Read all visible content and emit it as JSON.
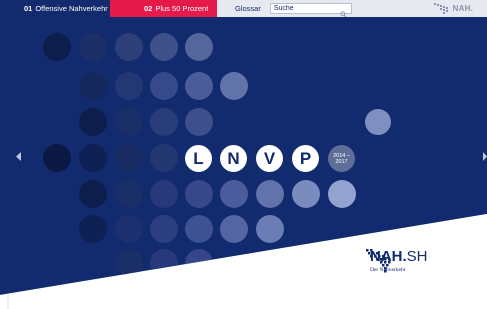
{
  "colors": {
    "navy": "#122a6e",
    "red": "#e5194a",
    "topbar_bg": "#e6e9f0",
    "white": "#ffffff"
  },
  "nav": {
    "tabs": [
      {
        "number": "01",
        "label": "Offensive Nahverkehr"
      },
      {
        "number": "02",
        "label": "Plus 50 Prozent"
      }
    ],
    "glossar_label": "Glossar",
    "search": {
      "placeholder": "Suche",
      "value": ""
    },
    "logo_text": "NAH."
  },
  "hero": {
    "letters": [
      "L",
      "N",
      "V",
      "P"
    ],
    "years": {
      "start": "2014 –",
      "end": "2017"
    }
  },
  "brand": {
    "name_bold": "NAH.",
    "name_rest": "SH",
    "tagline": "Der Nahverkehr"
  },
  "icons": {
    "prev": "chevron-left-icon",
    "next": "chevron-right-icon",
    "search": "search-icon",
    "logo": "pixel-logo-icon"
  }
}
